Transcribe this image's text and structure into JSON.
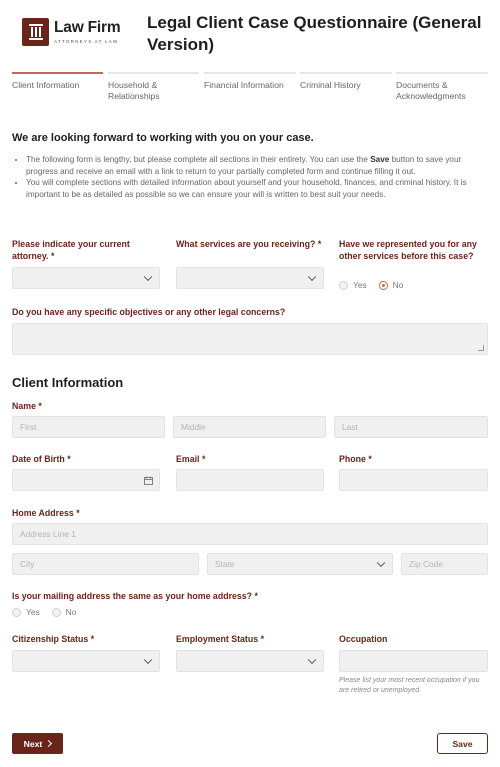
{
  "brand": {
    "name": "Law Firm",
    "tagline": "ATTORNEYS AT LAW",
    "color": "#6b2419"
  },
  "page_title": "Legal Client Case Questionnaire (General Version)",
  "steps": [
    {
      "label": "Client Information",
      "active": true
    },
    {
      "label": "Household & Relationships",
      "active": false
    },
    {
      "label": "Financial Information",
      "active": false
    },
    {
      "label": "Criminal History",
      "active": false
    },
    {
      "label": "Documents & Acknowledgments",
      "active": false
    }
  ],
  "intro": {
    "title": "We are looking forward to working with you on your case.",
    "bullet1_pre": "The following form is lengthy, but please complete all sections in their entirety. You can use the ",
    "bullet1_bold": "Save",
    "bullet1_post": " button to save your progress and receive an email with a link to return to your partially completed form and continue filling it out.",
    "bullet2": "You will complete sections with detailed information about yourself and your household, finances, and criminal history. It is important to be as detailed as possible so we can ensure your will is written to best suit your needs."
  },
  "questions": {
    "attorney_label": "Please indicate your current attorney.",
    "services_label": "What services are you receiving?",
    "represented_label": "Have we represented you for any other services before this case?",
    "represented_options": [
      "Yes",
      "No"
    ],
    "represented_selected": "No",
    "objectives_label": "Do you have any specific objectives or any other legal concerns?"
  },
  "client_info": {
    "heading": "Client Information",
    "name_label": "Name",
    "first_placeholder": "First",
    "middle_placeholder": "Middle",
    "last_placeholder": "Last",
    "dob_label": "Date of Birth",
    "email_label": "Email",
    "phone_label": "Phone",
    "address_label": "Home Address",
    "address_line1_placeholder": "Address Line 1",
    "city_placeholder": "City",
    "state_placeholder": "State",
    "zip_placeholder": "Zip Code",
    "mailing_label": "Is your mailing address the same as your home address?",
    "mailing_options": [
      "Yes",
      "No"
    ],
    "citizenship_label": "Citizenship Status",
    "employment_label": "Employment Status",
    "occupation_label": "Occupation",
    "occupation_help": "Please list your most recent occupation if you are retired or unemployed."
  },
  "buttons": {
    "next": "Next",
    "save": "Save"
  },
  "required_mark": "*",
  "icons": {
    "chevron": "chevron-down-icon",
    "calendar": "calendar-icon",
    "next": "chevron-right-icon"
  }
}
